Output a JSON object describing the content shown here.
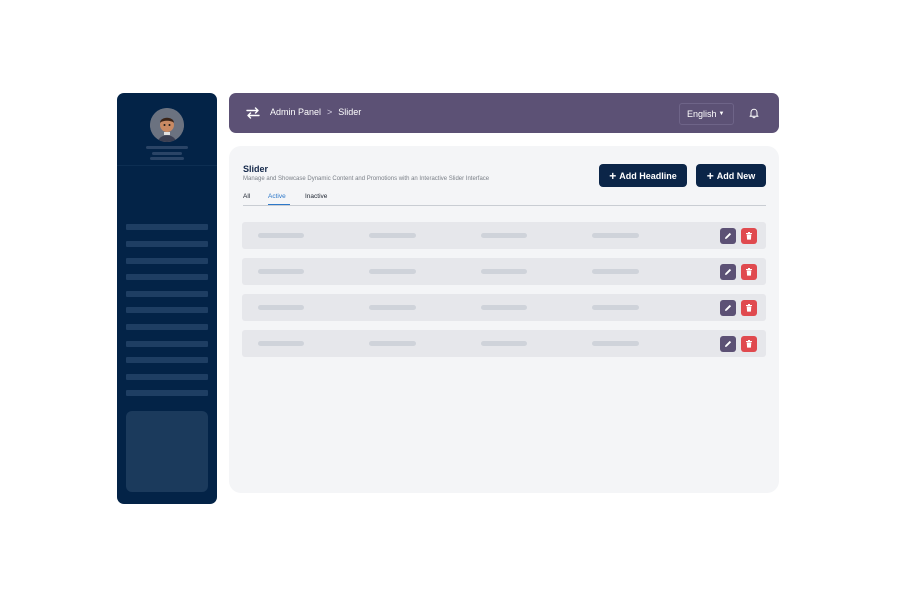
{
  "header": {
    "breadcrumb": [
      "Admin Panel",
      "Slider"
    ],
    "breadcrumb_separator": ">",
    "language": "English"
  },
  "page": {
    "title": "Slider",
    "subtitle": "Manage and Showcase Dynamic Content and Promotions with an Interactive Slider Interface"
  },
  "actions": {
    "add_headline": "Add Headline",
    "add_new": "Add New",
    "plus": "+"
  },
  "tabs": [
    {
      "label": "All",
      "active": false
    },
    {
      "label": "Active",
      "active": true
    },
    {
      "label": "Inactive",
      "active": false
    }
  ],
  "rows": [
    {
      "actions": [
        "edit",
        "delete"
      ]
    },
    {
      "actions": [
        "edit",
        "delete"
      ]
    },
    {
      "actions": [
        "edit",
        "delete"
      ]
    },
    {
      "actions": [
        "edit",
        "delete"
      ]
    }
  ],
  "icons": [
    "swap-icon",
    "bell-icon",
    "caret-down-icon",
    "edit-icon",
    "trash-icon"
  ],
  "colors": {
    "sidebar": "#032347",
    "topbar": "#5c5175",
    "primary_button": "#0b2548",
    "active_tab": "#2d78c9",
    "delete": "#e04a4f"
  }
}
